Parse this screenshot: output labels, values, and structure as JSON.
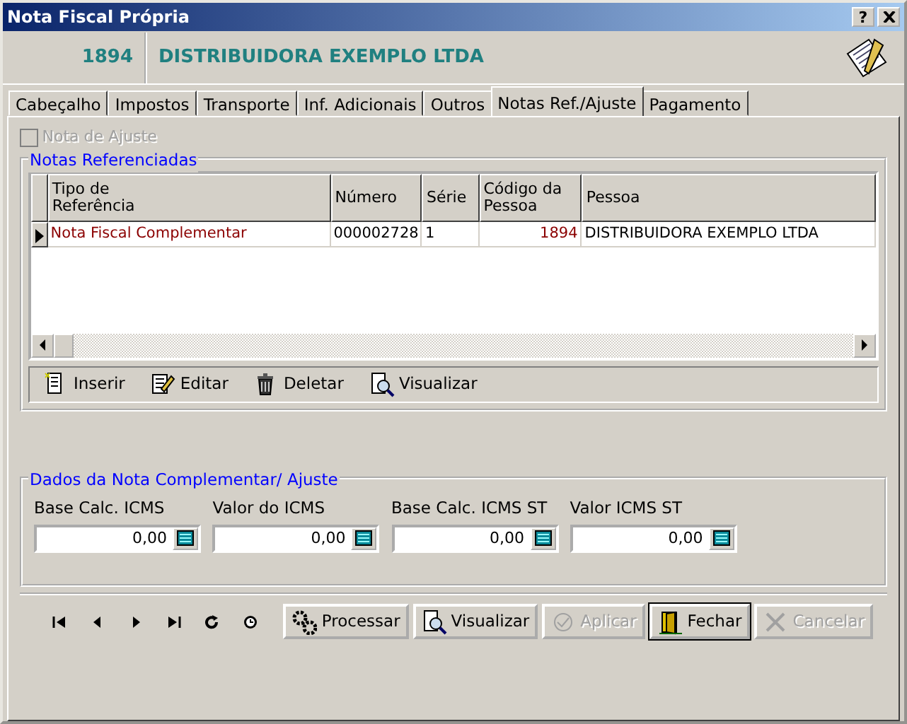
{
  "window": {
    "title": "Nota Fiscal Própria",
    "help": "?"
  },
  "header": {
    "code": "1894",
    "name": "DISTRIBUIDORA EXEMPLO LTDA"
  },
  "tabs": [
    {
      "label": "Cabeçalho",
      "selected": false
    },
    {
      "label": "Impostos",
      "selected": false
    },
    {
      "label": "Transporte",
      "selected": false
    },
    {
      "label": "Inf. Adicionais",
      "selected": false
    },
    {
      "label": "Outros",
      "selected": false
    },
    {
      "label": "Notas Ref./Ajuste",
      "selected": true
    },
    {
      "label": "Pagamento",
      "selected": false
    }
  ],
  "adjust_checkbox": {
    "label": "Nota de Ajuste",
    "checked": false,
    "disabled": true
  },
  "referenced_notes": {
    "title": "Notas Referenciadas",
    "columns": [
      "Tipo de\nReferência",
      "Número",
      "Série",
      "Código da\nPessoa",
      "Pessoa"
    ],
    "rows": [
      {
        "current": true,
        "cells": [
          "Nota Fiscal Complementar",
          "000002728",
          "1",
          "1894",
          "DISTRIBUIDORA EXEMPLO LTDA"
        ]
      }
    ],
    "toolbar": [
      {
        "kind": "insert",
        "label": "Inserir"
      },
      {
        "kind": "edit",
        "label": "Editar"
      },
      {
        "kind": "delete",
        "label": "Deletar"
      },
      {
        "kind": "view",
        "label": "Visualizar"
      }
    ]
  },
  "complement": {
    "title": "Dados da Nota Complementar/ Ajuste",
    "fields": [
      {
        "label": "Base Calc. ICMS",
        "value": "0,00"
      },
      {
        "label": "Valor do ICMS",
        "value": "0,00"
      },
      {
        "label": "Base Calc. ICMS ST",
        "value": "0,00"
      },
      {
        "label": "Valor ICMS ST",
        "value": "0,00"
      }
    ]
  },
  "navigation": [
    {
      "kind": "first"
    },
    {
      "kind": "prev"
    },
    {
      "kind": "next"
    },
    {
      "kind": "last"
    },
    {
      "kind": "refresh"
    },
    {
      "kind": "clock"
    }
  ],
  "buttons": [
    {
      "kind": "process",
      "label": "Processar",
      "disabled": false,
      "default": false
    },
    {
      "kind": "view",
      "label": "Visualizar",
      "disabled": false,
      "default": false
    },
    {
      "kind": "apply",
      "label": "Aplicar",
      "disabled": true,
      "default": false
    },
    {
      "kind": "close",
      "label": "Fechar",
      "disabled": false,
      "default": true
    },
    {
      "kind": "cancel",
      "label": "Cancelar",
      "disabled": true,
      "default": false
    }
  ]
}
